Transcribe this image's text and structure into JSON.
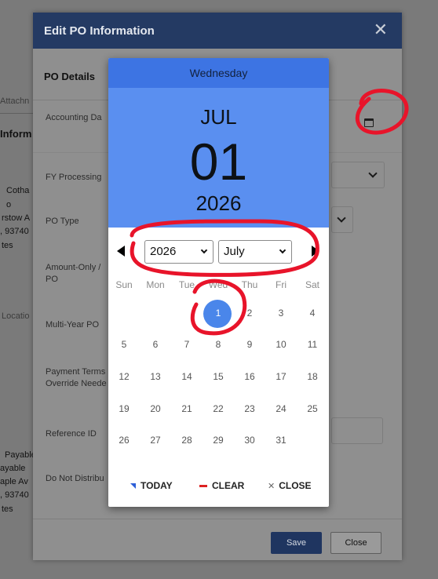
{
  "background": {
    "fragments": [
      "Attachn",
      "Inform",
      "Cotha",
      "o",
      "rstow A",
      ", 93740",
      "tes",
      "Locatio",
      "Payable",
      "ayable",
      "aple Av",
      ", 93740",
      "tes"
    ]
  },
  "modal": {
    "title": "Edit PO Information",
    "close_glyph": "✕",
    "section_title": "PO Details",
    "fields": {
      "accounting_date": "Accounting Da",
      "fy_processing": "FY Processing",
      "po_type": "PO Type",
      "amount_only": "Amount-Only / PO",
      "multi_year": "Multi-Year PO",
      "payment_terms": "Payment Terms Override Neede",
      "reference_id": "Reference ID",
      "do_not_distribute": "Do Not Distribu"
    },
    "save_label": "Save",
    "close_label": "Close"
  },
  "picker": {
    "weekday": "Wednesday",
    "month": "JUL",
    "day": "01",
    "year": "2026",
    "year_select": "2026",
    "month_select": "July",
    "weekday_headers": [
      "Sun",
      "Mon",
      "Tue",
      "Wed",
      "Thu",
      "Fri",
      "Sat"
    ],
    "days": [
      [
        "",
        "",
        "",
        "1",
        "2",
        "3",
        "4"
      ],
      [
        "5",
        "6",
        "7",
        "8",
        "9",
        "10",
        "11"
      ],
      [
        "12",
        "13",
        "14",
        "15",
        "16",
        "17",
        "18"
      ],
      [
        "19",
        "20",
        "21",
        "22",
        "23",
        "24",
        "25"
      ],
      [
        "26",
        "27",
        "28",
        "29",
        "30",
        "31",
        ""
      ]
    ],
    "selected_day": "1",
    "today_label": "TODAY",
    "clear_label": "CLEAR",
    "close_label": "CLOSE",
    "colors": {
      "header": "#3d74e3",
      "date_panel": "#5a8ff0",
      "selected": "#4a86ea",
      "annotation": "#e8142a"
    }
  }
}
